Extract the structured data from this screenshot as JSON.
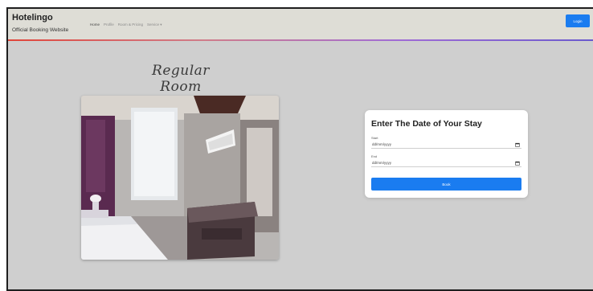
{
  "header": {
    "brand_name": "Hotelingo",
    "brand_tagline": "Official Booking Website",
    "nav_links": [
      {
        "label": "Home",
        "active": true
      },
      {
        "label": "Profile",
        "active": false
      },
      {
        "label": "Room & Pricing",
        "active": false
      },
      {
        "label": "Service ▾",
        "active": false
      }
    ],
    "login_label": "Login"
  },
  "room": {
    "title": "Regular Room"
  },
  "booking": {
    "title": "Enter The Date of Your Stay",
    "start_label": "Start",
    "start_value": "dd/mm/yyyy",
    "end_label": "End",
    "end_value": "dd/mm/yyyy",
    "book_label": "Book"
  },
  "colors": {
    "accent": "#1a7cf0",
    "background": "#cfcfcf",
    "navbar": "#deddd6"
  },
  "icons": {
    "start_calendar": "calendar-icon",
    "end_calendar": "calendar-icon"
  }
}
